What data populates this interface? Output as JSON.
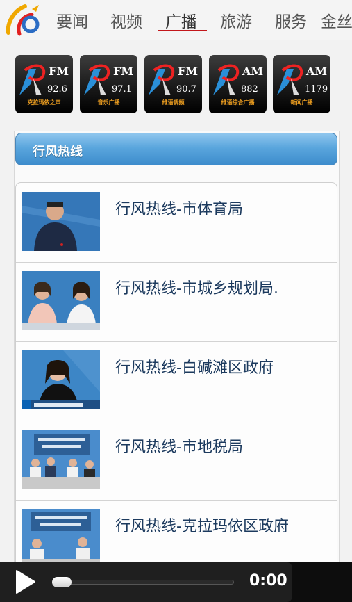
{
  "nav": {
    "items": [
      {
        "label": "要闻"
      },
      {
        "label": "视频"
      },
      {
        "label": "广播"
      },
      {
        "label": "旅游"
      },
      {
        "label": "服务"
      },
      {
        "label": "金丝"
      }
    ],
    "active_index": 2,
    "active_color": "#c3171b"
  },
  "stations": [
    {
      "band": "FM",
      "freq": "92.6",
      "name": "克拉玛依之声"
    },
    {
      "band": "FM",
      "freq": "97.1",
      "name": "音乐广播"
    },
    {
      "band": "FM",
      "freq": "90.7",
      "name": "维语调频"
    },
    {
      "band": "AM",
      "freq": "882",
      "name": "维语综合广播"
    },
    {
      "band": "AM",
      "freq": "1179",
      "name": "新闻广播"
    }
  ],
  "section": {
    "title": "行风热线"
  },
  "list": {
    "items": [
      {
        "title": "行风热线-市体育局",
        "thumb_icon": "man-in-dark-shirt-thumbnail"
      },
      {
        "title": "行风热线-市城乡规划局.",
        "thumb_icon": "two-women-studio-thumbnail"
      },
      {
        "title": "行风热线-白碱滩区政府",
        "thumb_icon": "woman-studio-thumbnail"
      },
      {
        "title": "行风热线-市地税局",
        "thumb_icon": "panel-desk-thumbnail"
      },
      {
        "title": "行风热线-克拉玛依区政府",
        "thumb_icon": "panel-desk-thumbnail"
      }
    ]
  },
  "player": {
    "time": "0:00",
    "progress": 0
  }
}
